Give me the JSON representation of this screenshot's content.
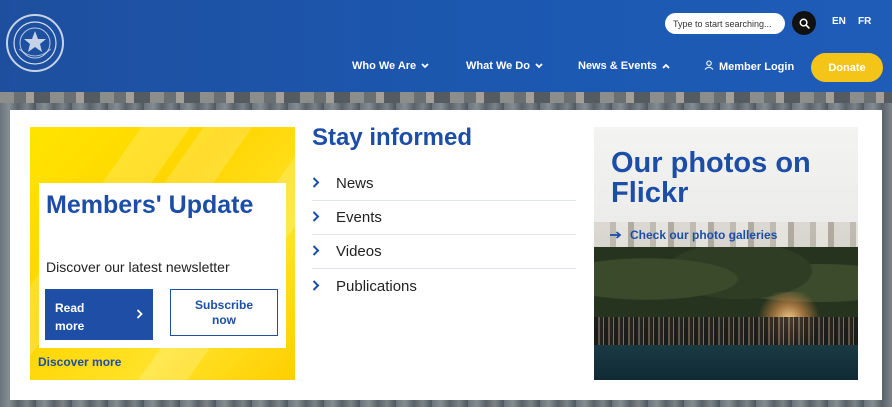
{
  "header": {
    "search": {
      "placeholder": "Type to start searching..."
    },
    "languages": [
      "EN",
      "FR"
    ],
    "nav": [
      {
        "label": "Who We Are",
        "chevron": "down"
      },
      {
        "label": "What We Do",
        "chevron": "down"
      },
      {
        "label": "News & Events",
        "chevron": "up",
        "expanded": true
      }
    ],
    "member_login": "Member Login",
    "donate": "Donate"
  },
  "dropdown": {
    "promo": {
      "title": "Members' Update",
      "subtitle": "Discover our latest newsletter",
      "read_more": "Read more",
      "subscribe": "Subscribe now",
      "discover_more": "Discover more"
    },
    "stay_informed": {
      "title": "Stay informed",
      "items": [
        "News",
        "Events",
        "Videos",
        "Publications"
      ]
    },
    "flickr": {
      "title": "Our photos on Flickr",
      "link": "Check our photo galleries"
    }
  },
  "colors": {
    "header_blue": "#1e56ad",
    "brand_blue": "#1c4ea8",
    "donate_yellow": "#f5c418",
    "promo_yellow": "#ffde00"
  },
  "icons": {
    "logo": "seal-logo",
    "search": "search-icon",
    "login": "user-icon",
    "list_chevron": "chevron-right-icon",
    "link_arrow": "arrow-right-icon"
  }
}
